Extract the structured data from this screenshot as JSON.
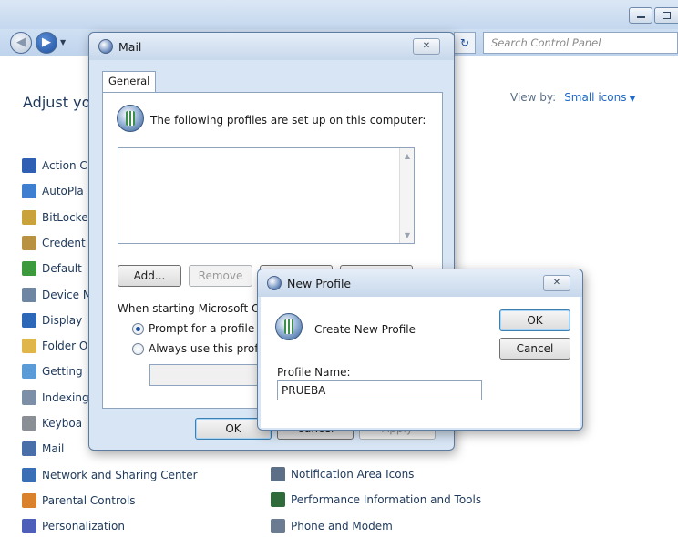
{
  "control_panel": {
    "search_placeholder": "Search Control Panel",
    "heading": "Adjust yo",
    "view_by_label": "View by:",
    "view_by_value": "Small icons",
    "items_left": [
      {
        "label": "Action C",
        "icon": "flag-icon",
        "color": "#2f5fb3"
      },
      {
        "label": "AutoPla",
        "icon": "autoplay-icon",
        "color": "#3f7fcf"
      },
      {
        "label": "BitLocke",
        "icon": "bitlocker-icon",
        "color": "#c9a23c"
      },
      {
        "label": "Credent",
        "icon": "credential-icon",
        "color": "#b89240"
      },
      {
        "label": "Default",
        "icon": "default-programs-icon",
        "color": "#3c9a3c"
      },
      {
        "label": "Device M",
        "icon": "device-manager-icon",
        "color": "#6f86a3"
      },
      {
        "label": "Display",
        "icon": "display-icon",
        "color": "#2d67b8"
      },
      {
        "label": "Folder O",
        "icon": "folder-options-icon",
        "color": "#e0b64a"
      },
      {
        "label": "Getting",
        "icon": "getting-started-icon",
        "color": "#5a9bd8"
      },
      {
        "label": "Indexing",
        "icon": "indexing-icon",
        "color": "#7d8fa6"
      },
      {
        "label": "Keyboa",
        "icon": "keyboard-icon",
        "color": "#8a8f96"
      },
      {
        "label": "Mail",
        "icon": "mail-icon",
        "color": "#4a6ea8"
      },
      {
        "label": "Network and Sharing Center",
        "icon": "network-icon",
        "color": "#3a6fb5"
      },
      {
        "label": "Parental Controls",
        "icon": "parental-controls-icon",
        "color": "#d9822b"
      },
      {
        "label": "Personalization",
        "icon": "personalization-icon",
        "color": "#4d5fb8"
      }
    ],
    "items_right": [
      {
        "label": "Notification Area Icons",
        "icon": "notification-icon",
        "color": "#5d6f86"
      },
      {
        "label": "Performance Information and Tools",
        "icon": "performance-icon",
        "color": "#2f6b3a"
      },
      {
        "label": "Phone and Modem",
        "icon": "phone-icon",
        "color": "#6b7c92"
      }
    ]
  },
  "mail_dialog": {
    "title": "Mail",
    "tab_label": "General",
    "profiles_text": "The following profiles are set up on this computer:",
    "add_button": "Add...",
    "remove_button": "Remove",
    "startup_text": "When starting Microsoft Offi",
    "radio_prompt": "Prompt for a profile to",
    "radio_always": "Always use this profile",
    "ok_button": "OK",
    "cancel_button": "Cancel",
    "apply_button": "Apply"
  },
  "new_profile_dialog": {
    "title": "New Profile",
    "heading": "Create New Profile",
    "ok_button": "OK",
    "cancel_button": "Cancel",
    "name_label": "Profile Name:",
    "name_value": "PRUEBA"
  }
}
